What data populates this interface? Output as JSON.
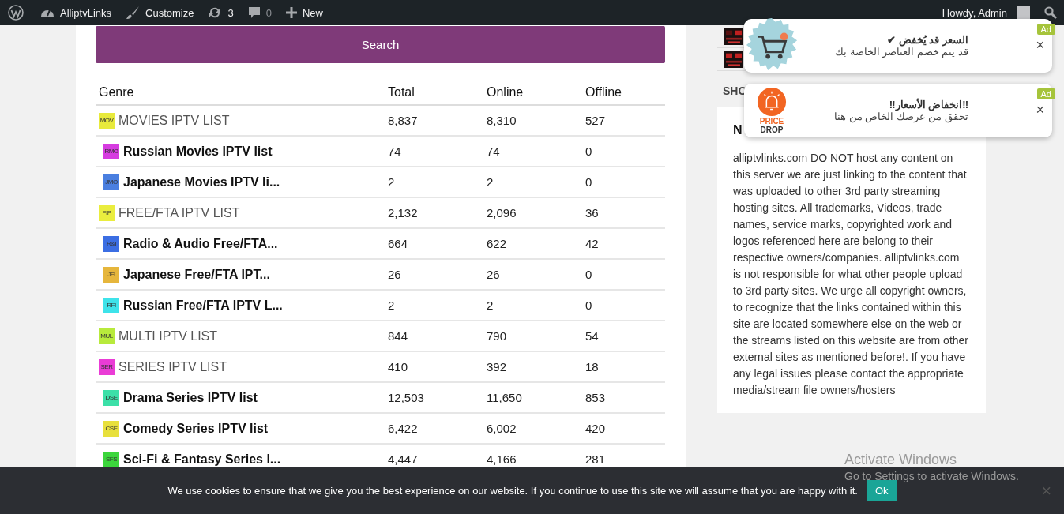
{
  "admin_bar": {
    "items": [
      {
        "kind": "wp"
      },
      {
        "kind": "site",
        "label": "AlliptvLinks"
      },
      {
        "kind": "customize",
        "label": "Customize"
      },
      {
        "kind": "updates",
        "label": "3"
      },
      {
        "kind": "comments",
        "label": "0"
      },
      {
        "kind": "new",
        "label": "New"
      }
    ],
    "account": "Howdy, Admin"
  },
  "search_button": "Search",
  "table": {
    "columns": [
      "Genre",
      "Total",
      "Online",
      "Offline"
    ],
    "rows": [
      {
        "kind": "parent",
        "badge": "MOV",
        "color": "#e8ea3c",
        "genre": "MOVIES IPTV LIST",
        "total": "8,837",
        "online": "8,310",
        "offline": "527"
      },
      {
        "kind": "child",
        "badge": "RMO",
        "color": "#d63ce0",
        "genre": "Russian Movies IPTV list",
        "total": "74",
        "online": "74",
        "offline": "0"
      },
      {
        "kind": "child",
        "badge": "JMO",
        "color": "#4a7fe0",
        "genre": "Japanese Movies IPTV li...",
        "total": "2",
        "online": "2",
        "offline": "0"
      },
      {
        "kind": "parent",
        "badge": "FIP",
        "color": "#eaed3e",
        "genre": "FREE/FTA IPTV LIST",
        "total": "2,132",
        "online": "2,096",
        "offline": "36"
      },
      {
        "kind": "child",
        "badge": "R&I",
        "color": "#3b6ee3",
        "genre": "Radio & Audio Free/FTA...",
        "total": "664",
        "online": "622",
        "offline": "42"
      },
      {
        "kind": "child",
        "badge": "JFI",
        "color": "#e6b63c",
        "genre": "Japanese Free/FTA IPT...",
        "total": "26",
        "online": "26",
        "offline": "0"
      },
      {
        "kind": "child",
        "badge": "RFI",
        "color": "#3ee3ea",
        "genre": "Russian Free/FTA IPTV L...",
        "total": "2",
        "online": "2",
        "offline": "0"
      },
      {
        "kind": "parent",
        "badge": "MUL",
        "color": "#b8ea3c",
        "genre": "MULTI IPTV LIST",
        "total": "844",
        "online": "790",
        "offline": "54"
      },
      {
        "kind": "parent",
        "badge": "SER",
        "color": "#ea3cd6",
        "genre": "SERIES IPTV LIST",
        "total": "410",
        "online": "392",
        "offline": "18"
      },
      {
        "kind": "child",
        "badge": "DSE",
        "color": "#3ce0a8",
        "genre": "Drama Series IPTV list",
        "total": "12,503",
        "online": "11,650",
        "offline": "853"
      },
      {
        "kind": "child",
        "badge": "CSE",
        "color": "#e8e03c",
        "genre": "Comedy Series IPTV list",
        "total": "6,422",
        "online": "6,002",
        "offline": "420"
      },
      {
        "kind": "child",
        "badge": "SFS",
        "color": "#3cd63c",
        "genre": "Sci-Fi & Fantasy Series l...",
        "total": "4,447",
        "online": "4,166",
        "offline": "281"
      }
    ]
  },
  "sidebar": {
    "show_more": "SHO",
    "notice": {
      "title": "N",
      "text": "alliptvlinks.com DO NOT host any content on this server we are just linking to the content that was uploaded to other 3rd party streaming hosting sites. All trademarks, Videos, trade names, service marks, copyrighted work and logos referenced here are belong to their respective owners/companies. alliptvlinks.com is not responsible for what other people upload to 3rd party sites. We urge all copyright owners, to recognize that the links contained within this site are located somewhere else on the web or the streams listed on this website are from other external sites as mentioned before!. If you have any legal issues please contact the appropriate media/stream file owners/hosters"
    }
  },
  "notifications": [
    {
      "kind": "cart",
      "title": "السعر قد يُخفض ✔",
      "text": "قد يتم خصم العناصر الخاصة بك",
      "badge": "Ad",
      "close": "×"
    },
    {
      "kind": "price_drop",
      "icon_text": [
        "PRICE",
        "DROP"
      ],
      "title": "‼انخفاض الأسعار‼",
      "text": "تحقق من عرضك الخاص من هنا",
      "badge": "Ad",
      "close": "×"
    }
  ],
  "windows_notice": {
    "title": "Activate Windows",
    "text": "Go to Settings to activate Windows."
  },
  "cookie_bar": {
    "text": "We use cookies to ensure that we give you the best experience on our website. If you continue to use this site we will assume that you are happy with it.",
    "button": "Ok",
    "close": "×"
  }
}
